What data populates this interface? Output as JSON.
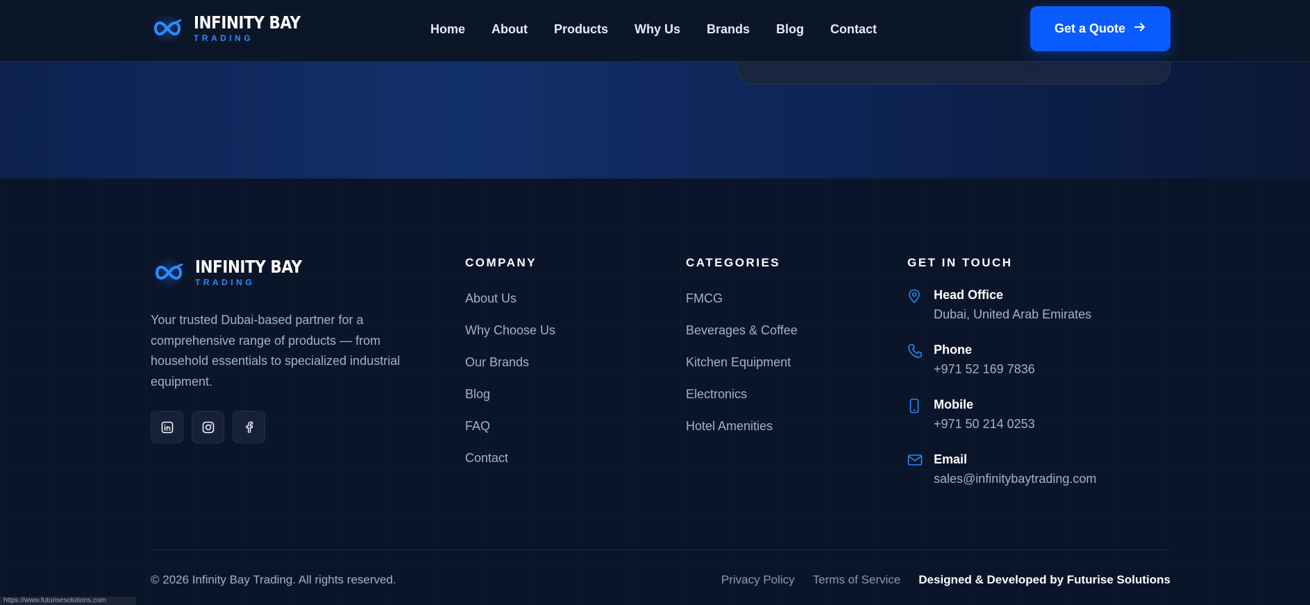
{
  "brand": {
    "title": "INFINITY BAY",
    "subtitle": "TRADING",
    "accent_color": "#2b8cff",
    "logo_icon": "infinity-logo-icon"
  },
  "nav": {
    "items": [
      "Home",
      "About",
      "Products",
      "Why Us",
      "Brands",
      "Blog",
      "Contact"
    ],
    "cta_label": "Get a Quote",
    "cta_icon": "arrow-right-icon",
    "cta_color": "#0a5cff"
  },
  "footer": {
    "description": "Your trusted Dubai-based partner for a comprehensive range of products — from household essentials to specialized industrial equipment.",
    "socials": [
      {
        "name": "linkedin-icon"
      },
      {
        "name": "instagram-icon"
      },
      {
        "name": "facebook-icon"
      }
    ],
    "company": {
      "title": "COMPANY",
      "links": [
        "About Us",
        "Why Choose Us",
        "Our Brands",
        "Blog",
        "FAQ",
        "Contact"
      ]
    },
    "categories": {
      "title": "CATEGORIES",
      "links": [
        "FMCG",
        "Beverages & Coffee",
        "Kitchen Equipment",
        "Electronics",
        "Hotel Amenities"
      ]
    },
    "contact": {
      "title": "GET IN TOUCH",
      "items": [
        {
          "icon": "map-pin-icon",
          "label": "Head Office",
          "value": "Dubai, United Arab Emirates"
        },
        {
          "icon": "phone-icon",
          "label": "Phone",
          "value": "+971 52 169 7836"
        },
        {
          "icon": "mobile-icon",
          "label": "Mobile",
          "value": "+971 50 214 0253"
        },
        {
          "icon": "mail-icon",
          "label": "Email",
          "value": "sales@infinitybaytrading.com"
        }
      ]
    },
    "copyright": "© 2026 Infinity Bay Trading. All rights reserved.",
    "bottom_links": {
      "privacy": "Privacy Policy",
      "terms": "Terms of Service",
      "credit": "Designed & Developed by Futurise Solutions"
    }
  },
  "status_bar": {
    "url": "https://www.futurisesolutions.com"
  }
}
